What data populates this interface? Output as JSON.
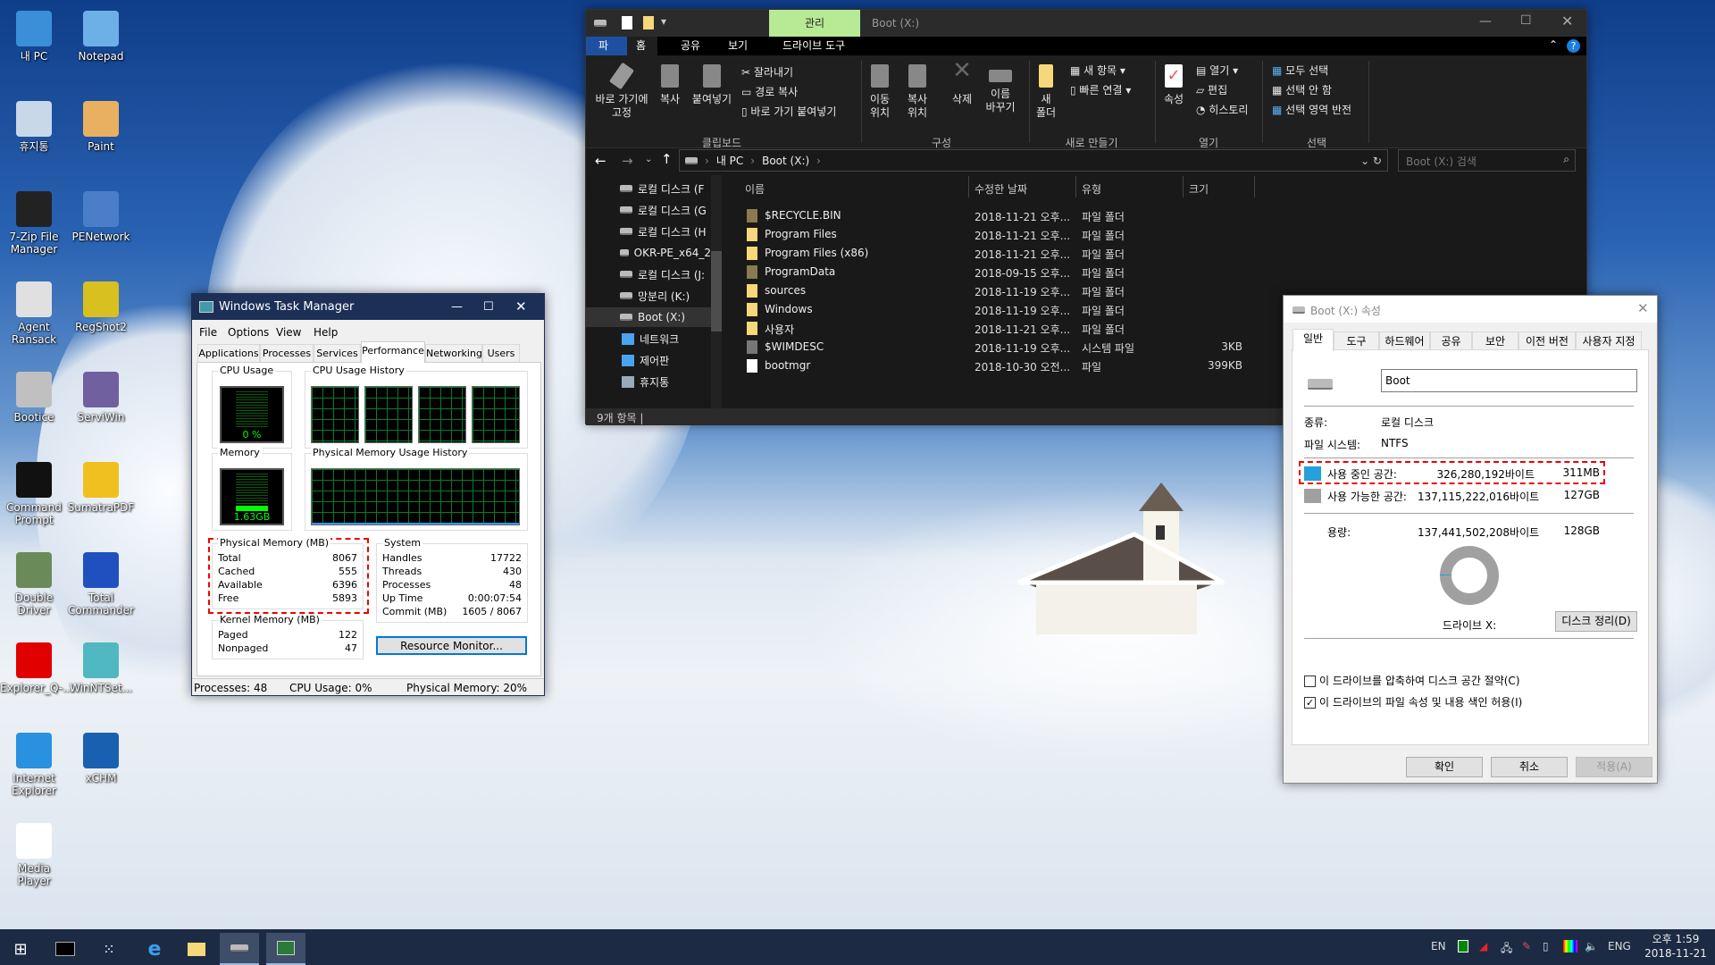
{
  "desktop": {
    "icons": [
      {
        "label": "내 PC",
        "icon": "computer-icon",
        "color": "#3a8fd8"
      },
      {
        "label": "Notepad",
        "icon": "notepad-icon",
        "color": "#6db0e8"
      },
      {
        "label": "휴지통",
        "icon": "recycle-bin-icon",
        "color": "#c8d8e8"
      },
      {
        "label": "Paint",
        "icon": "paint-palette-icon",
        "color": "#e8b060"
      },
      {
        "label": "7-Zip File Manager",
        "icon": "7zip-icon",
        "color": "#222222"
      },
      {
        "label": "PENetwork",
        "icon": "network-icon",
        "color": "#4a7ec8"
      },
      {
        "label": "Agent Ransack",
        "icon": "agent-ransack-icon",
        "color": "#e0e0e0"
      },
      {
        "label": "RegShot2",
        "icon": "regshot-icon",
        "color": "#d8c020"
      },
      {
        "label": "Bootice",
        "icon": "bootice-icon",
        "color": "#c0c0c0"
      },
      {
        "label": "ServiWin",
        "icon": "serviwin-icon",
        "color": "#7060a0"
      },
      {
        "label": "Command Prompt",
        "icon": "command-prompt-icon",
        "color": "#111111"
      },
      {
        "label": "SumatraPDF",
        "icon": "pdf-icon",
        "color": "#f0c020"
      },
      {
        "label": "Double Driver",
        "icon": "double-driver-icon",
        "color": "#6a8a5a"
      },
      {
        "label": "Total Commander",
        "icon": "floppy-disk-icon",
        "color": "#2050c0"
      },
      {
        "label": "Explorer_Q-...",
        "icon": "explorer-q-icon",
        "color": "#e00000"
      },
      {
        "label": "WinNTSet...",
        "icon": "winntsetup-icon",
        "color": "#50b8c0"
      },
      {
        "label": "Internet Explorer",
        "icon": "internet-explorer-icon",
        "color": "#2a90e0"
      },
      {
        "label": "xCHM",
        "icon": "xchm-icon",
        "color": "#1a60b0"
      },
      {
        "label": "Media Player",
        "icon": "media-player-icon",
        "color": "#ffffff"
      }
    ]
  },
  "explorer": {
    "title": "Boot (X:)",
    "context_tab": "관리",
    "context_color": "#b8e994",
    "tabs": [
      "파일",
      "홈",
      "공유",
      "보기",
      "드라이브 도구"
    ],
    "ribbon": {
      "pin": "바로 가기에\n고정",
      "copy": "복사",
      "paste": "붙여넣기",
      "cut": "잘라내기",
      "copy_path": "경로 복사",
      "paste_shortcut": "바로 가기 붙여넣기",
      "move_to": "이동\n위치",
      "copy_to": "복사\n위치",
      "delete": "삭제",
      "rename": "이름\n바꾸기",
      "new_folder": "새\n폴더",
      "new_item": "새 항목",
      "easy_access": "빠른 연결",
      "properties": "속성",
      "open": "열기",
      "edit": "편집",
      "history": "히스토리",
      "select_all": "모두 선택",
      "select_none": "선택 안 함",
      "invert_selection": "선택 영역 반전",
      "groups": [
        "클립보드",
        "구성",
        "새로 만들기",
        "열기",
        "선택"
      ]
    },
    "address": {
      "crumbs": [
        "내 PC",
        "Boot (X:)"
      ],
      "search_placeholder": "Boot (X:) 검색"
    },
    "nav": [
      {
        "label": "로컬 디스크 (F",
        "type": "drive"
      },
      {
        "label": "로컬 디스크 (G",
        "type": "drive"
      },
      {
        "label": "로컬 디스크 (H",
        "type": "drive"
      },
      {
        "label": "OKR-PE_x64_2",
        "type": "drive"
      },
      {
        "label": "로컬 디스크 (J:",
        "type": "drive"
      },
      {
        "label": "망분리 (K:)",
        "type": "drive"
      },
      {
        "label": "Boot (X:)",
        "type": "drive",
        "selected": true
      },
      {
        "label": "네트워크",
        "type": "network"
      },
      {
        "label": "제어판",
        "type": "control-panel"
      },
      {
        "label": "휴지통",
        "type": "recycle-bin"
      }
    ],
    "columns": [
      "이름",
      "수정한 날짜",
      "유형",
      "크기"
    ],
    "files": [
      {
        "name": "$RECYCLE.BIN",
        "date": "2018-11-21 오후...",
        "type": "파일 폴더",
        "size": "",
        "icon": "system-folder"
      },
      {
        "name": "Program Files",
        "date": "2018-11-21 오후...",
        "type": "파일 폴더",
        "size": "",
        "icon": "folder"
      },
      {
        "name": "Program Files (x86)",
        "date": "2018-11-21 오후...",
        "type": "파일 폴더",
        "size": "",
        "icon": "folder"
      },
      {
        "name": "ProgramData",
        "date": "2018-09-15 오후...",
        "type": "파일 폴더",
        "size": "",
        "icon": "system-folder"
      },
      {
        "name": "sources",
        "date": "2018-11-19 오후...",
        "type": "파일 폴더",
        "size": "",
        "icon": "folder"
      },
      {
        "name": "Windows",
        "date": "2018-11-19 오후...",
        "type": "파일 폴더",
        "size": "",
        "icon": "folder"
      },
      {
        "name": "사용자",
        "date": "2018-11-21 오후...",
        "type": "파일 폴더",
        "size": "",
        "icon": "folder"
      },
      {
        "name": "$WIMDESC",
        "date": "2018-11-19 오후...",
        "type": "시스템 파일",
        "size": "3KB",
        "icon": "system-file"
      },
      {
        "name": "bootmgr",
        "date": "2018-10-30 오전...",
        "type": "파일",
        "size": "399KB",
        "icon": "file"
      }
    ],
    "status": "9개 항목"
  },
  "taskmgr": {
    "title": "Windows Task Manager",
    "menu": [
      "File",
      "Options",
      "View",
      "Help"
    ],
    "tabs": [
      "Applications",
      "Processes",
      "Services",
      "Performance",
      "Networking",
      "Users"
    ],
    "active_tab": "Performance",
    "cpu_usage_label": "CPU Usage",
    "cpu_usage_value": "0 %",
    "cpu_percent": 0,
    "cpu_history_label": "CPU Usage History",
    "memory_label": "Memory",
    "memory_value": "1.63GB",
    "memory_percent": 20,
    "mem_history_label": "Physical Memory Usage History",
    "physical": {
      "title": "Physical Memory (MB)",
      "rows": [
        [
          "Total",
          "8067"
        ],
        [
          "Cached",
          "555"
        ],
        [
          "Available",
          "6396"
        ],
        [
          "Free",
          "5893"
        ]
      ]
    },
    "kernel": {
      "title": "Kernel Memory (MB)",
      "rows": [
        [
          "Paged",
          "122"
        ],
        [
          "Nonpaged",
          "47"
        ]
      ]
    },
    "system": {
      "title": "System",
      "rows": [
        [
          "Handles",
          "17722"
        ],
        [
          "Threads",
          "430"
        ],
        [
          "Processes",
          "48"
        ],
        [
          "Up Time",
          "0:00:07:54"
        ],
        [
          "Commit (MB)",
          "1605 / 8067"
        ]
      ]
    },
    "resource_monitor": "Resource Monitor...",
    "status": {
      "processes": "Processes: 48",
      "cpu": "CPU Usage: 0%",
      "memory": "Physical Memory: 20%"
    }
  },
  "props": {
    "title": "Boot (X:) 속성",
    "tabs": [
      "일반",
      "도구",
      "하드웨어",
      "공유",
      "보안",
      "이전 버전",
      "사용자 지정"
    ],
    "name_value": "Boot",
    "type_label": "종류:",
    "type_value": "로컬 디스크",
    "fs_label": "파일 시스템:",
    "fs_value": "NTFS",
    "used_label": "사용 중인 공간:",
    "used_bytes": "326,280,192바이트",
    "used_size": "311MB",
    "used_color": "#26a0da",
    "free_label": "사용 가능한 공간:",
    "free_bytes": "137,115,222,016바이트",
    "free_size": "127GB",
    "free_color": "#a0a0a0",
    "cap_label": "용량:",
    "cap_bytes": "137,441,502,208바이트",
    "cap_size": "128GB",
    "used_fraction": 0.0024,
    "drive_label": "드라이브 X:",
    "cleanup": "디스크 정리(D)",
    "compress": {
      "label": "이 드라이브를 압축하여 디스크 공간 절약(C)",
      "checked": false
    },
    "index": {
      "label": "이 드라이브의 파일 속성 및 내용 색인 허용(I)",
      "checked": true
    },
    "ok": "확인",
    "cancel": "취소",
    "apply": "적용(A)"
  },
  "taskbar": {
    "items": [
      "start",
      "command-prompt",
      "task-view",
      "internet-explorer",
      "file-explorer",
      "drive",
      "task-manager"
    ],
    "tray": {
      "lang1": "EN",
      "lang2": "ENG",
      "time": "오후 1:59",
      "date": "2018-11-21"
    }
  }
}
